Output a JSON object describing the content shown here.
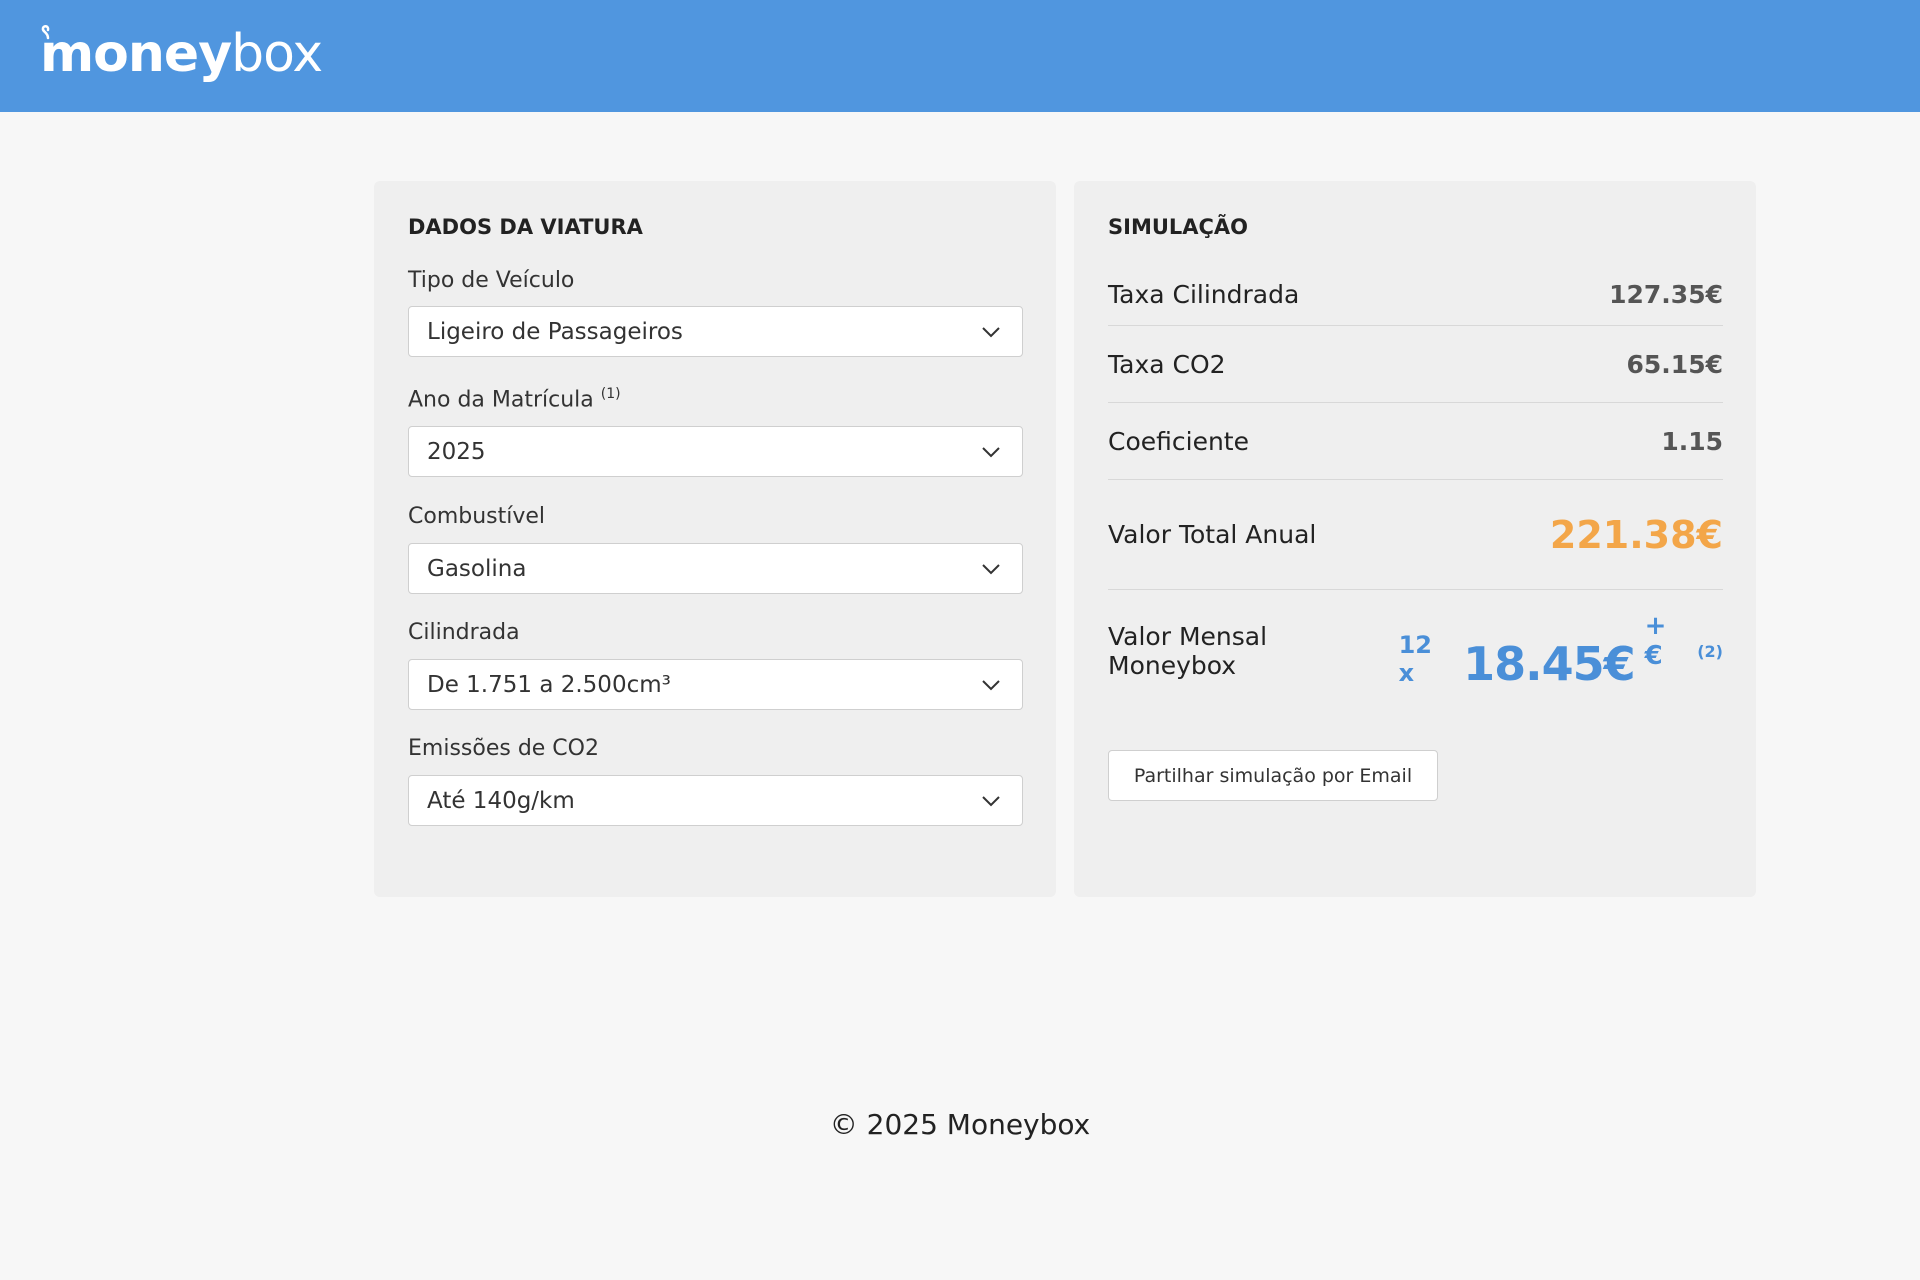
{
  "brand": {
    "money": "money",
    "box": "box",
    "header_color": "#5096df"
  },
  "vehicle": {
    "title": "DADOS DA VIATURA",
    "fields": [
      {
        "label": "Tipo de Veículo",
        "note": "",
        "value": "Ligeiro de Passageiros"
      },
      {
        "label": "Ano da Matrícula",
        "note": "(1)",
        "value": "2025"
      },
      {
        "label": "Combustível",
        "note": "",
        "value": "Gasolina"
      },
      {
        "label": "Cilindrada",
        "note": "",
        "value": "De 1.751 a 2.500cm³"
      },
      {
        "label": "Emissões de CO2",
        "note": "",
        "value": "Até 140g/km"
      }
    ]
  },
  "simulation": {
    "title": "SIMULAÇÃO",
    "rows": [
      {
        "label": "Taxa Cilindrada",
        "value": "127.35€"
      },
      {
        "label": "Taxa CO2",
        "value": "65.15€"
      },
      {
        "label": "Coeficiente",
        "value": "1.15"
      }
    ],
    "total": {
      "label": "Valor Total Anual",
      "value": "221.38€",
      "color": "#f3a649"
    },
    "monthly": {
      "label": "Valor Mensal Moneybox",
      "times": "12 x",
      "amount": "18.45€",
      "plus": "+ €",
      "note": "(2)",
      "color": "#4a8fd8"
    },
    "share_button": "Partilhar simulação por Email"
  },
  "footer": {
    "copyright": "© 2025 Moneybox"
  }
}
